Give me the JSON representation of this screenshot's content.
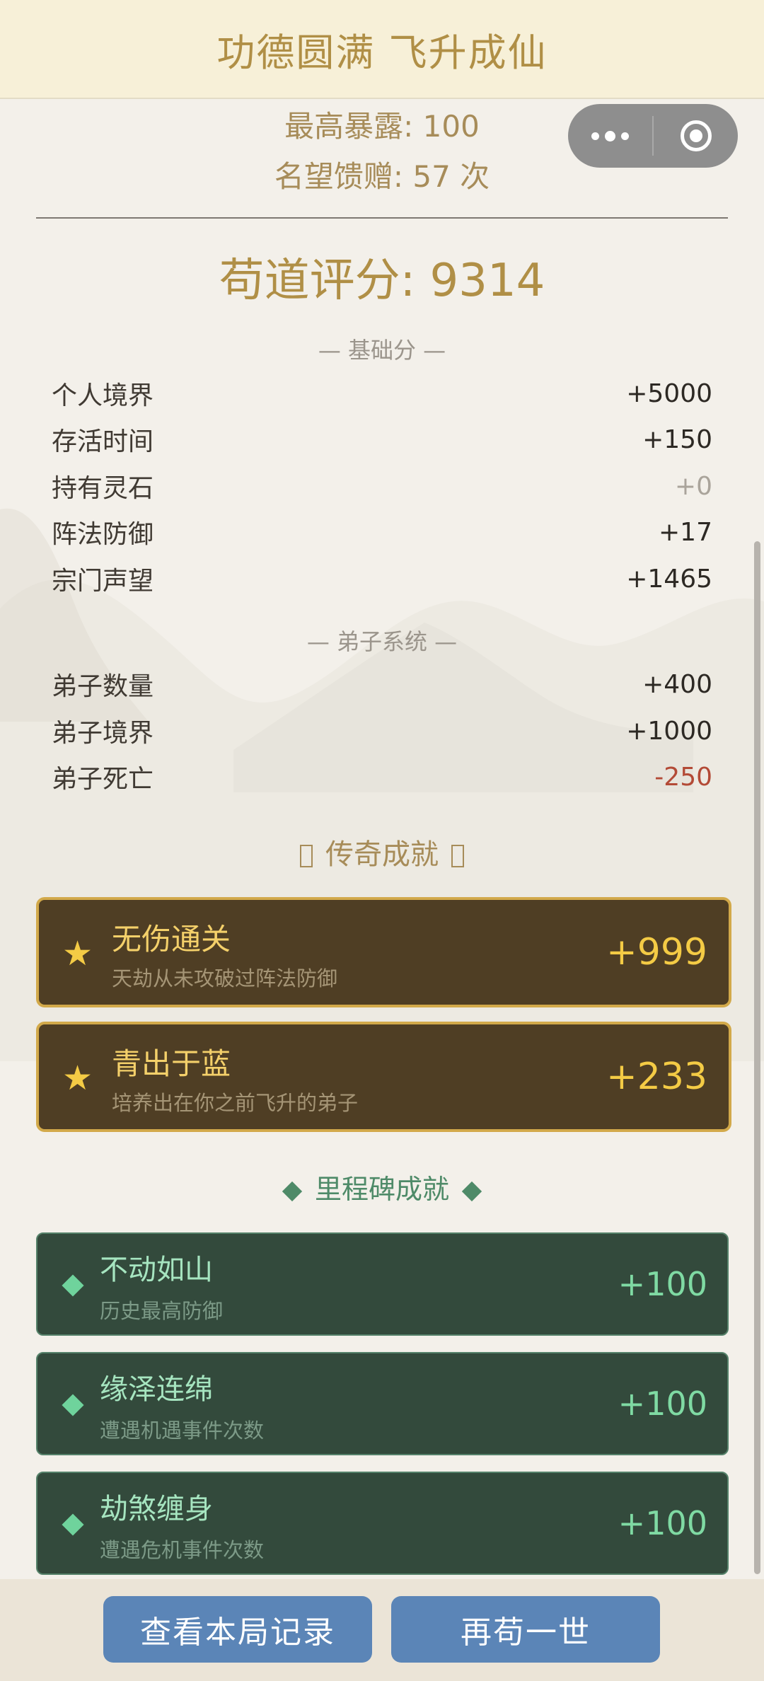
{
  "header": {
    "title": "功德圆满 飞升成仙"
  },
  "stats": {
    "max_exposure": "最高暴露: 100",
    "reputation_gifts": "名望馈赠: 57 次"
  },
  "score": {
    "label": "苟道评分: 9314"
  },
  "basic": {
    "heading": "— 基础分 —",
    "rows": [
      {
        "name": "个人境界",
        "value": "+5000"
      },
      {
        "name": "存活时间",
        "value": "+150"
      },
      {
        "name": "持有灵石",
        "value": "+0"
      },
      {
        "name": "阵法防御",
        "value": "+17"
      },
      {
        "name": "宗门声望",
        "value": "+1465"
      }
    ]
  },
  "disciples": {
    "heading": "— 弟子系统 —",
    "rows": [
      {
        "name": "弟子数量",
        "value": "+400"
      },
      {
        "name": "弟子境界",
        "value": "+1000"
      },
      {
        "name": "弟子死亡",
        "value": "-250"
      }
    ]
  },
  "legendary": {
    "heading": "传奇成就",
    "items": [
      {
        "title": "无伤通关",
        "desc": "天劫从未攻破过阵法防御",
        "points": "+999"
      },
      {
        "title": "青出于蓝",
        "desc": "培养出在你之前飞升的弟子",
        "points": "+233"
      }
    ]
  },
  "milestone": {
    "heading": "里程碑成就",
    "items": [
      {
        "title": "不动如山",
        "desc": "历史最高防御",
        "points": "+100"
      },
      {
        "title": "缘泽连绵",
        "desc": "遭遇机遇事件次数",
        "points": "+100"
      },
      {
        "title": "劫煞缠身",
        "desc": "遭遇危机事件次数",
        "points": "+100"
      }
    ]
  },
  "buttons": {
    "view_record": "查看本局记录",
    "retry": "再苟一世"
  },
  "colors": {
    "gold": "#b08f46",
    "legend_bg": "#4f3e24",
    "milestone_bg": "#334a3c",
    "button_blue": "#5b85b7",
    "negative": "#b34a36"
  }
}
